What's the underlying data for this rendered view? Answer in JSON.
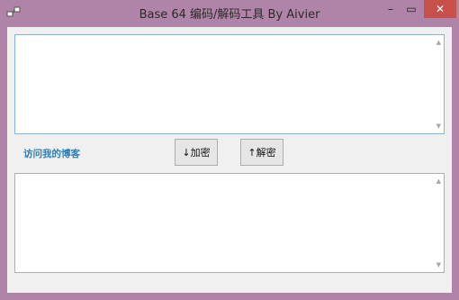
{
  "window": {
    "title": "Base 64 编码/解码工具 By Aivier",
    "controls": {
      "minimize": "–",
      "maximize": "▭",
      "close": "✕"
    }
  },
  "main": {
    "input_text": "",
    "output_text": "",
    "blog_link": "访问我的博客",
    "encrypt_button": "↓加密",
    "decrypt_button": "↑解密"
  },
  "scrollbar": {
    "up": "▲",
    "down": "▼"
  }
}
